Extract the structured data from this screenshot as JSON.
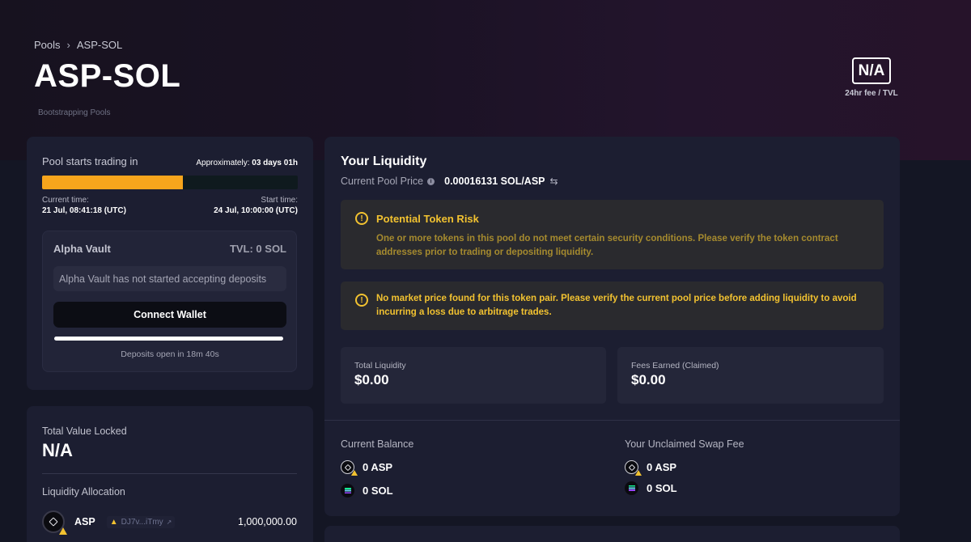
{
  "breadcrumb": {
    "root": "Pools",
    "current": "ASP-SOL"
  },
  "page": {
    "title": "ASP-SOL",
    "pool_type": "Bootstrapping Pools"
  },
  "fee": {
    "value": "N/A",
    "label": "24hr fee / TVL"
  },
  "trading": {
    "label": "Pool starts trading in",
    "approx_prefix": "Approximately:",
    "approx_value": "03 days 01h",
    "progress_fraction": 0.55,
    "current_time_label": "Current time:",
    "current_time": "21 Jul, 08:41:18 (UTC)",
    "start_time_label": "Start time:",
    "start_time": "24 Jul, 10:00:00 (UTC)"
  },
  "vault": {
    "name": "Alpha Vault",
    "tvl": "TVL: 0 SOL",
    "message": "Alpha Vault has not started accepting deposits",
    "connect_label": "Connect Wallet",
    "progress_fraction": 1.0,
    "deposits_text": "Deposits open in 18m 40s"
  },
  "tvl_card": {
    "label": "Total Value Locked",
    "value": "N/A",
    "allocation_label": "Liquidity Allocation",
    "allocation": [
      {
        "symbol": "ASP",
        "address": "DJ7v...iTmy",
        "amount": "1,000,000.00"
      }
    ]
  },
  "liquidity": {
    "title": "Your Liquidity",
    "price_label": "Current Pool Price",
    "price_value": "0.00016131 SOL/ASP",
    "alert_risk_title": "Potential Token Risk",
    "alert_risk_body": "One or more tokens in this pool do not meet certain security conditions. Please verify the token contract addresses prior to trading or depositing liquidity.",
    "alert_price_body": "No market price found for this token pair. Please verify the current pool price before adding liquidity to avoid incurring a loss due to arbitrage trades.",
    "total_liquidity_label": "Total Liquidity",
    "total_liquidity_value": "$0.00",
    "fees_label": "Fees Earned (Claimed)",
    "fees_value": "$0.00",
    "balance_label": "Current Balance",
    "balance_asp": "0 ASP",
    "balance_sol": "0 SOL",
    "unclaimed_label": "Your Unclaimed Swap Fee",
    "unclaimed_asp": "0 ASP",
    "unclaimed_sol": "0 SOL"
  },
  "colors": {
    "accent_orange": "#f7a51c",
    "warning_yellow": "#f2c230",
    "card_bg": "#1c1e31"
  }
}
